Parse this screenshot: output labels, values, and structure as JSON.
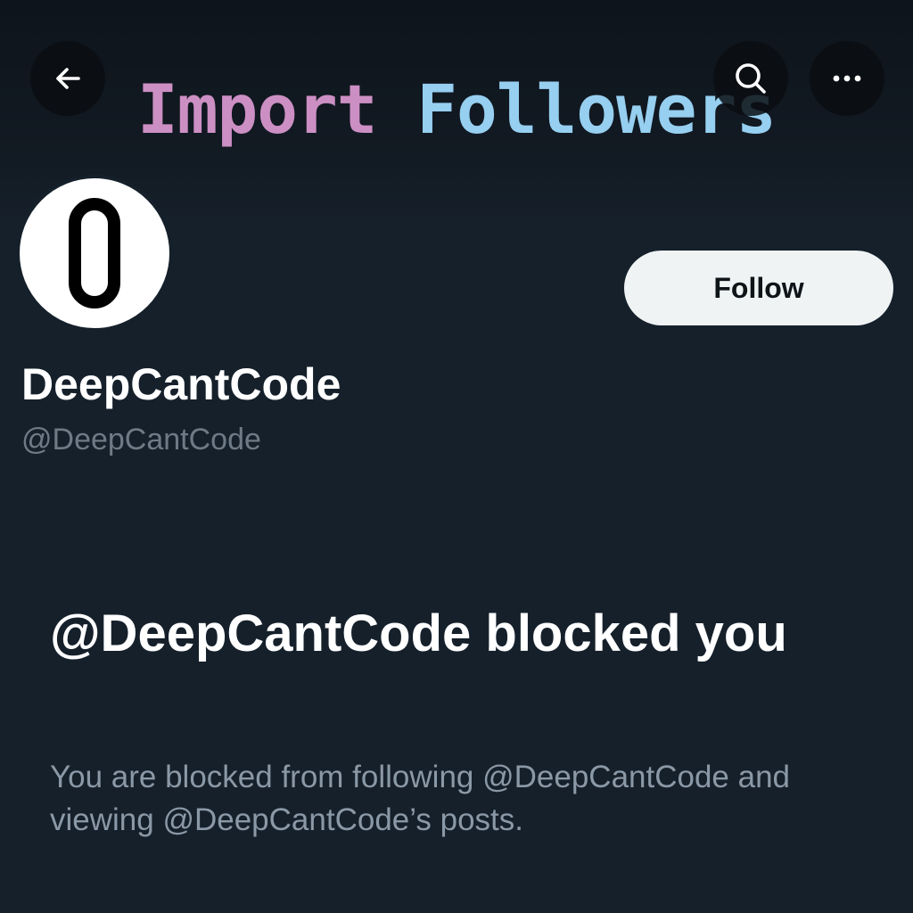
{
  "header": {
    "title_part1": "Import",
    "title_part2": "Followers",
    "back_icon": "arrow-left-icon",
    "search_icon": "search-icon",
    "more_icon": "more-horizontal-icon"
  },
  "profile": {
    "avatar_icon": "zero-logo",
    "follow_label": "Follow",
    "display_name": "DeepCantCode",
    "handle": "@DeepCantCode"
  },
  "blocked": {
    "title": "@DeepCantCode blocked you",
    "description": "You are blocked from following @DeepCantCode and viewing @DeepCantCode’s posts."
  },
  "colors": {
    "background": "#15202b",
    "title_pink": "#cc8fc3",
    "title_blue": "#96cff0",
    "button_bg": "#eff3f4",
    "muted_text": "#8b98a5"
  }
}
